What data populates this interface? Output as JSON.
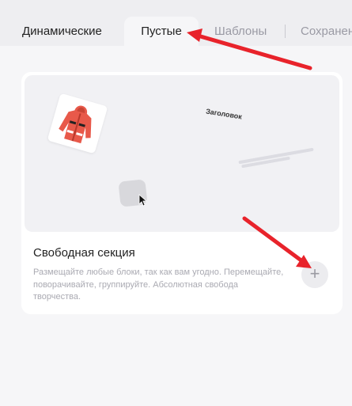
{
  "tabs": [
    {
      "label": "Динамические",
      "active": false
    },
    {
      "label": "Пустые",
      "active": true
    },
    {
      "label": "Шаблоны",
      "active": false
    },
    {
      "label": "Сохранен",
      "active": false
    }
  ],
  "card": {
    "preview_heading": "Заголовок",
    "title": "Свободная секция",
    "description": "Размещайте любые блоки, так как вам угодно. Перемещайте, поворачивайте, группируйте. Абсолютная свобода творчества.",
    "add_button_icon": "+"
  },
  "colors": {
    "annotation_arrow": "#e8232b",
    "jacket": "#e8594a"
  }
}
